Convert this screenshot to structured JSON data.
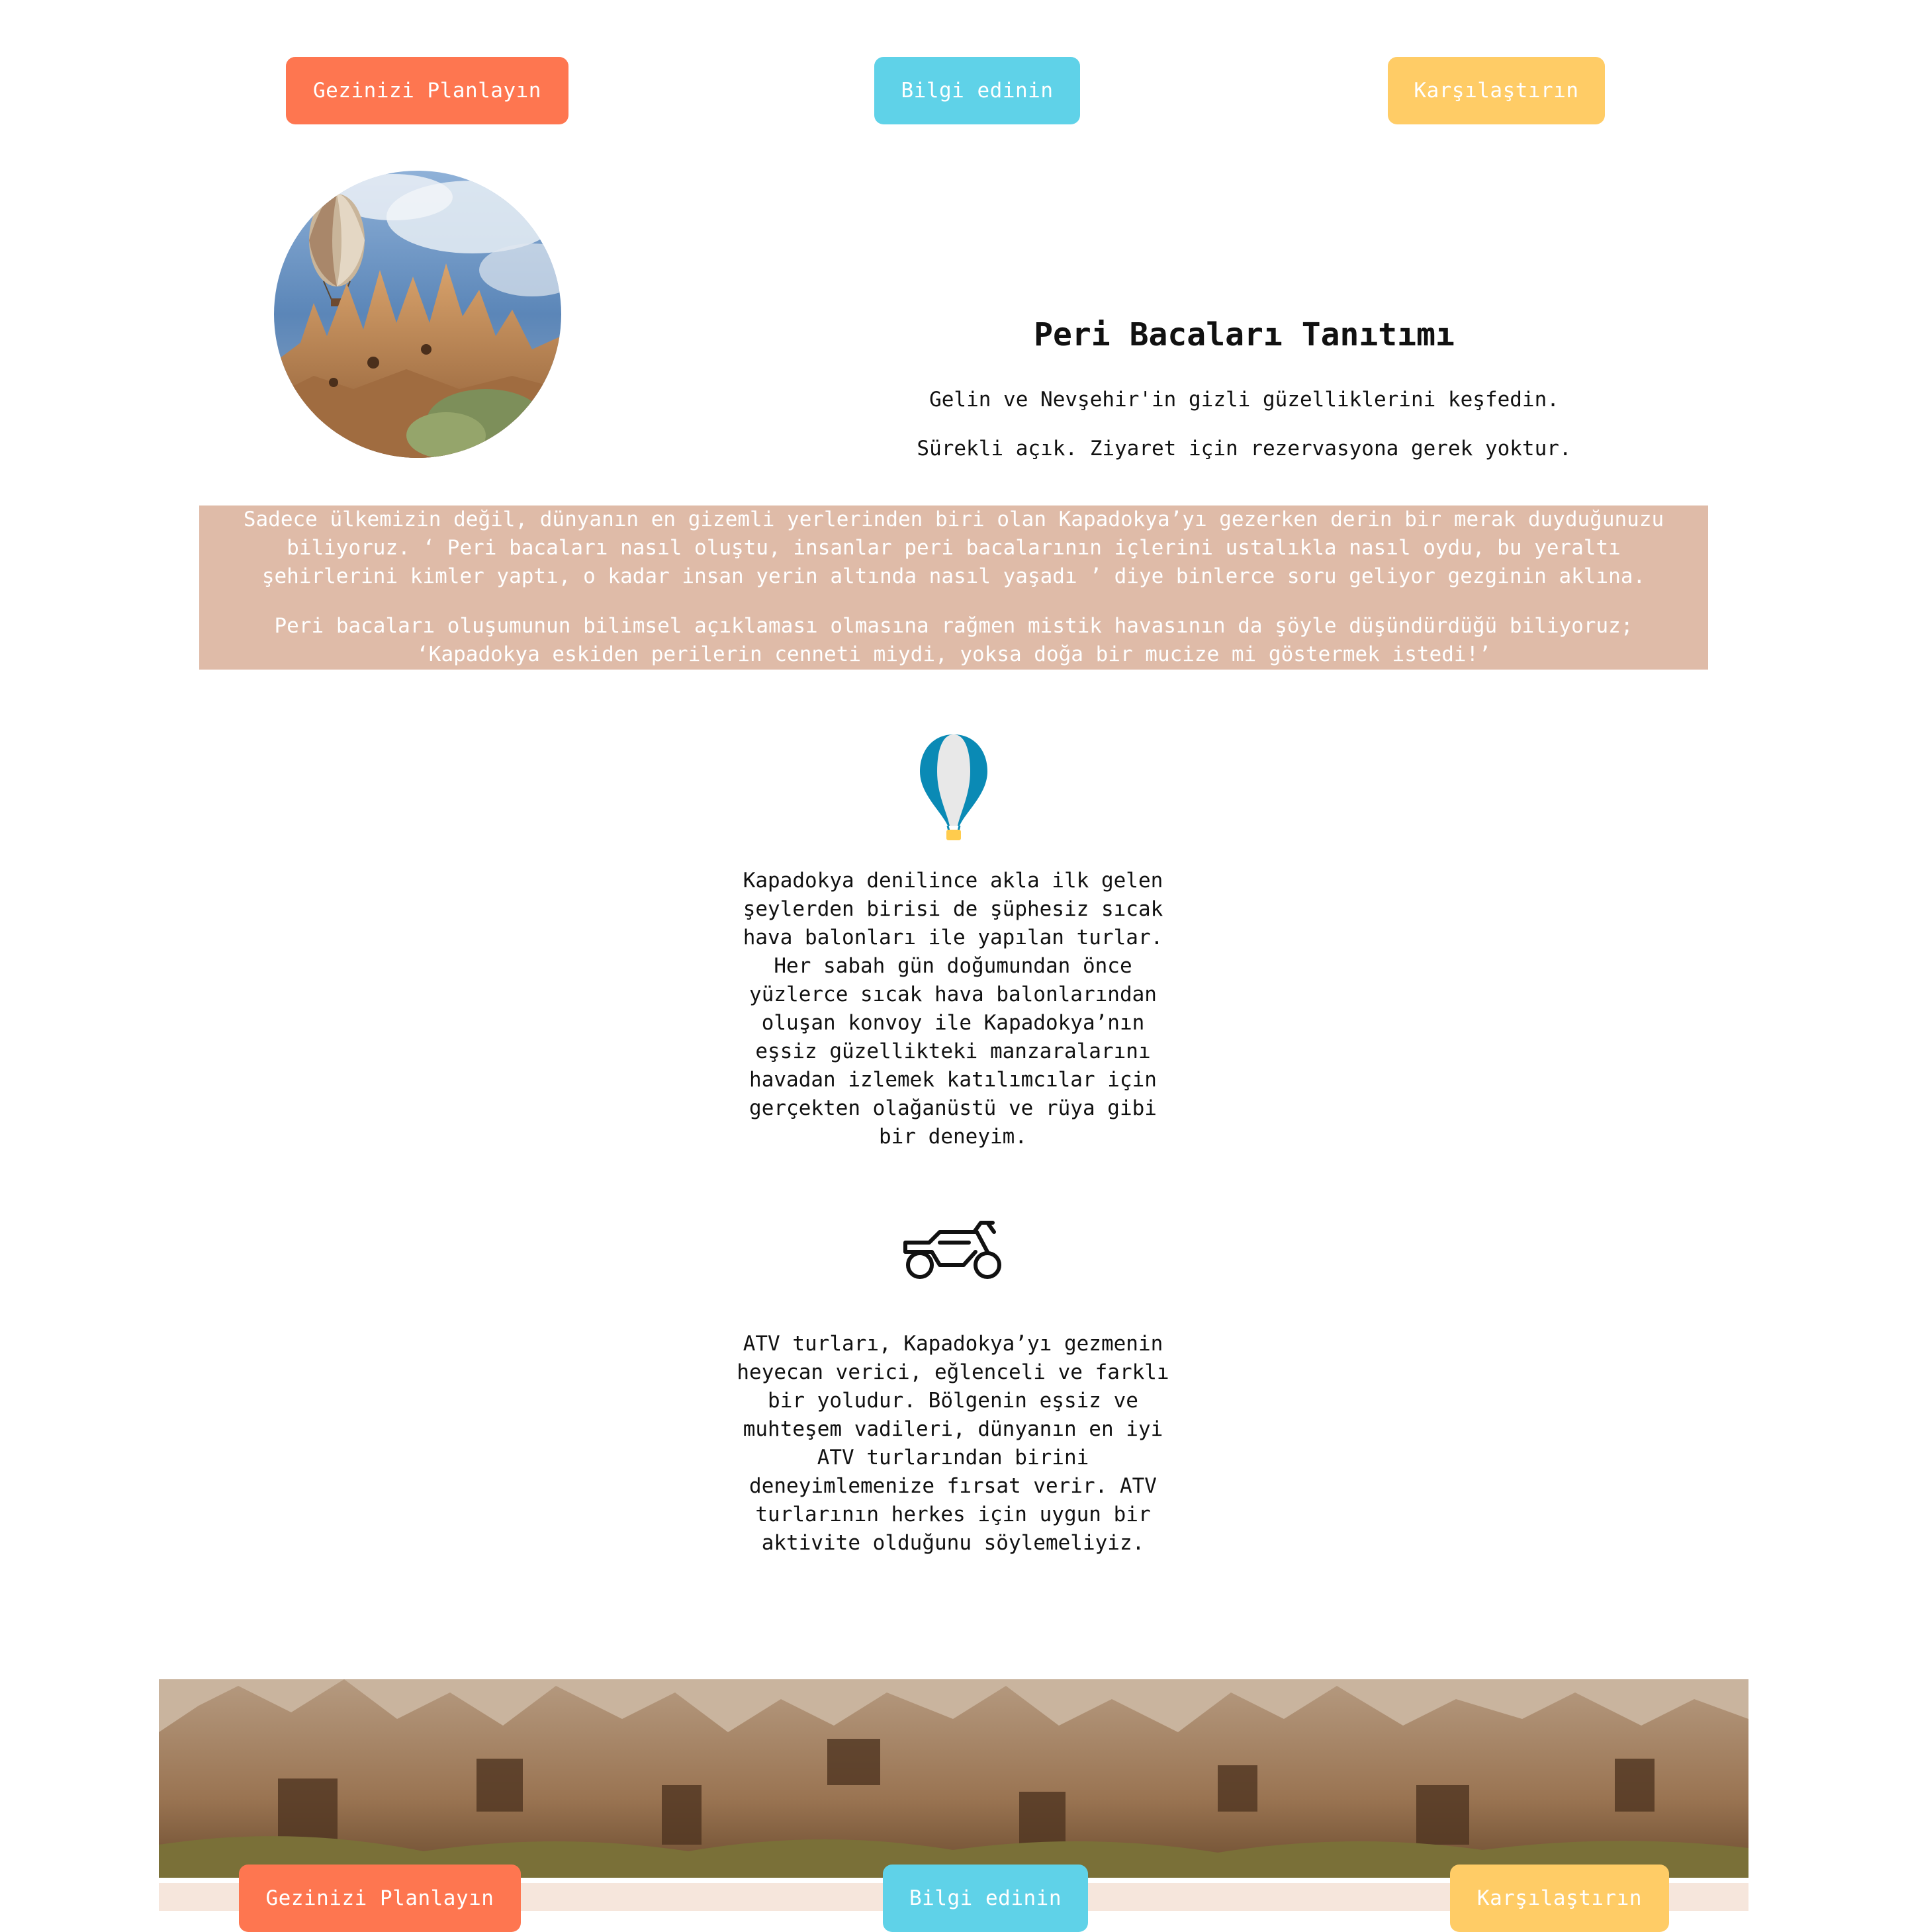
{
  "top_nav": {
    "plan_label": "Gezinizi Planlayın",
    "info_label": "Bilgi edinin",
    "compare_label": "Karşılaştırın"
  },
  "intro": {
    "title": "Peri Bacaları Tanıtımı",
    "line1": "Gelin ve Nevşehir'in gizli güzelliklerini keşfedin.",
    "line2": "Sürekli açık. Ziyaret için rezervasyona gerek yoktur."
  },
  "info_band": {
    "paragraph1": "Sadece ülkemizin değil, dünyanın en gizemli yerlerinden biri olan Kapadokya’yı gezerken derin bir merak duyduğunuzu biliyoruz. ‘ Peri bacaları nasıl oluştu, insanlar peri bacalarının içlerini ustalıkla nasıl oydu, bu yeraltı şehirlerini kimler yaptı, o kadar insan yerin altında nasıl yaşadı ’ diye binlerce soru geliyor gezginin aklına.",
    "paragraph2": "Peri bacaları oluşumunun bilimsel açıklaması olmasına rağmen mistik havasının da şöyle düşündürdüğü biliyoruz; ‘Kapadokya eskiden perilerin cenneti miydi, yoksa doğa bir mucize mi göstermek istedi!’"
  },
  "activities": {
    "balloon_text": "Kapadokya denilince akla ilk gelen şeylerden birisi de şüphesiz sıcak hava balonları ile yapılan turlar. Her sabah gün doğumundan önce yüzlerce sıcak hava balonlarından oluşan konvoy ile Kapadokya’nın eşsiz güzellikteki manzaralarını havadan izlemek katılımcılar için gerçekten olağanüstü ve rüya gibi bir deneyim.",
    "atv_text": "ATV turları, Kapadokya’yı gezmenin heyecan verici, eğlenceli ve farklı bir yoludur. Bölgenin eşsiz ve muhteşem vadileri, dünyanın en iyi ATV turlarından birini deneyimlemenize fırsat verir. ATV turlarının herkes için uygun bir aktivite olduğunu söylemeliyiz."
  },
  "icons": {
    "balloon": "hot-air-balloon-icon",
    "atv": "atv-icon"
  },
  "bottom_nav": {
    "plan_label": "Gezinizi Planlayın",
    "info_label": "Bilgi edinin",
    "compare_label": "Karşılaştırın"
  },
  "colors": {
    "orange": "#fe7650",
    "cyan": "#5fd2e8",
    "yellow": "#ffcc66",
    "band": "#dfbba8",
    "strip": "#f6e6dc"
  }
}
